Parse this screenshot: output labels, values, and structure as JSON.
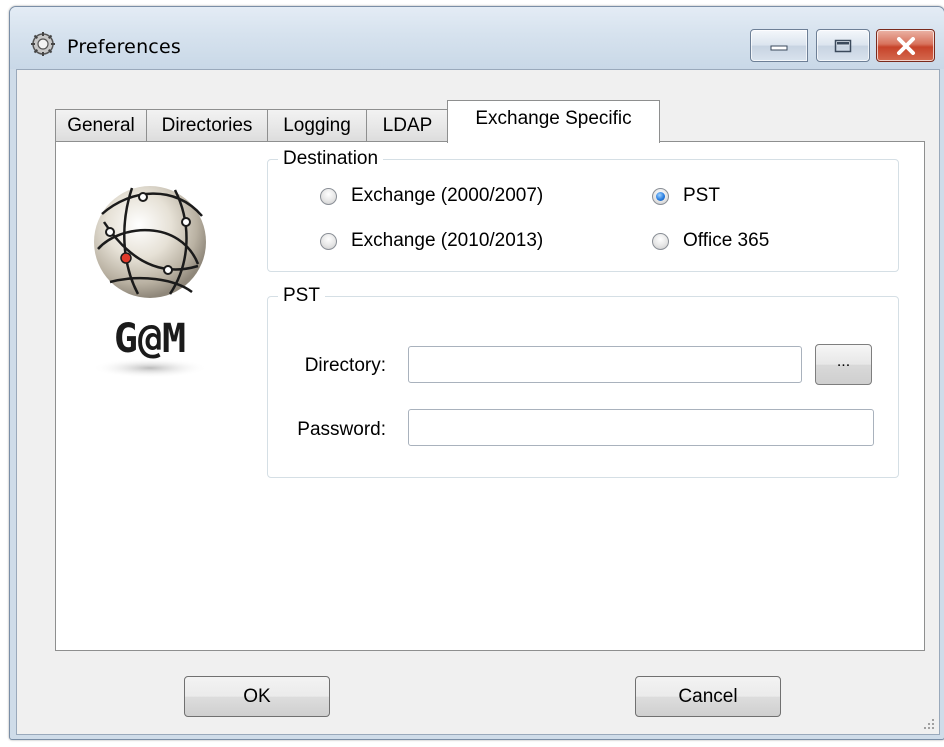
{
  "window": {
    "title": "Preferences"
  },
  "tabs": [
    {
      "label": "General",
      "active": false
    },
    {
      "label": "Directories",
      "active": false
    },
    {
      "label": "Logging",
      "active": false
    },
    {
      "label": "LDAP",
      "active": false
    },
    {
      "label": "Exchange Specific",
      "active": true
    }
  ],
  "logo": {
    "text": "G@M"
  },
  "destination": {
    "legend": "Destination",
    "options": [
      {
        "label": "Exchange (2000/2007)",
        "checked": false
      },
      {
        "label": "PST",
        "checked": true
      },
      {
        "label": "Exchange (2010/2013)",
        "checked": false
      },
      {
        "label": "Office 365",
        "checked": false
      }
    ]
  },
  "pst": {
    "legend": "PST",
    "directory_label": "Directory:",
    "directory_value": "",
    "browse_label": "...",
    "password_label": "Password:",
    "password_value": ""
  },
  "buttons": {
    "ok": "OK",
    "cancel": "Cancel"
  },
  "colors": {
    "radio_checked": "#2a7ee0",
    "close_button": "#c6432a",
    "window_frame": "#cfdce9"
  },
  "icons": [
    "app-gear-icon",
    "minimize-icon",
    "maximize-icon",
    "close-icon",
    "size-grip-icon"
  ]
}
